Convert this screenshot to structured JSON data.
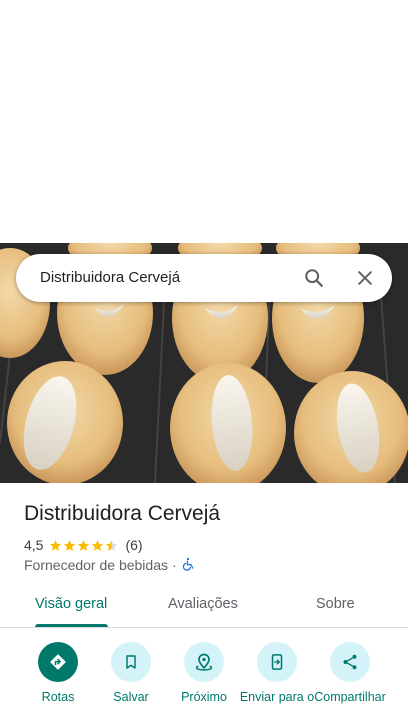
{
  "search": {
    "query": "Distribuidora Cervejá",
    "search_icon": "search-icon",
    "close_icon": "close-icon"
  },
  "photo": {
    "description_icon": "place-photo"
  },
  "place": {
    "name": "Distribuidora Cervejá",
    "rating": "4,5",
    "rating_value": 4.5,
    "review_count": "(6)",
    "category": "Fornecedor de bebidas",
    "separator": "·",
    "accessibility_icon": "wheelchair-icon"
  },
  "tabs": [
    {
      "label": "Visão geral",
      "active": true
    },
    {
      "label": "Avaliações",
      "active": false
    },
    {
      "label": "Sobre",
      "active": false
    }
  ],
  "actions": [
    {
      "label": "Rotas",
      "icon": "directions-icon",
      "primary": true
    },
    {
      "label": "Salvar",
      "icon": "bookmark-icon",
      "primary": false
    },
    {
      "label": "Próximo",
      "icon": "nearby-icon",
      "primary": false
    },
    {
      "label": "Enviar para o",
      "icon": "send-to-phone-icon",
      "primary": false
    },
    {
      "label": "Compartilhar",
      "icon": "share-icon",
      "primary": false
    }
  ],
  "colors": {
    "accent": "#00796b",
    "action_bg": "#d3f3f8",
    "star": "#fbbc04",
    "accessibility": "#1a73e8"
  }
}
